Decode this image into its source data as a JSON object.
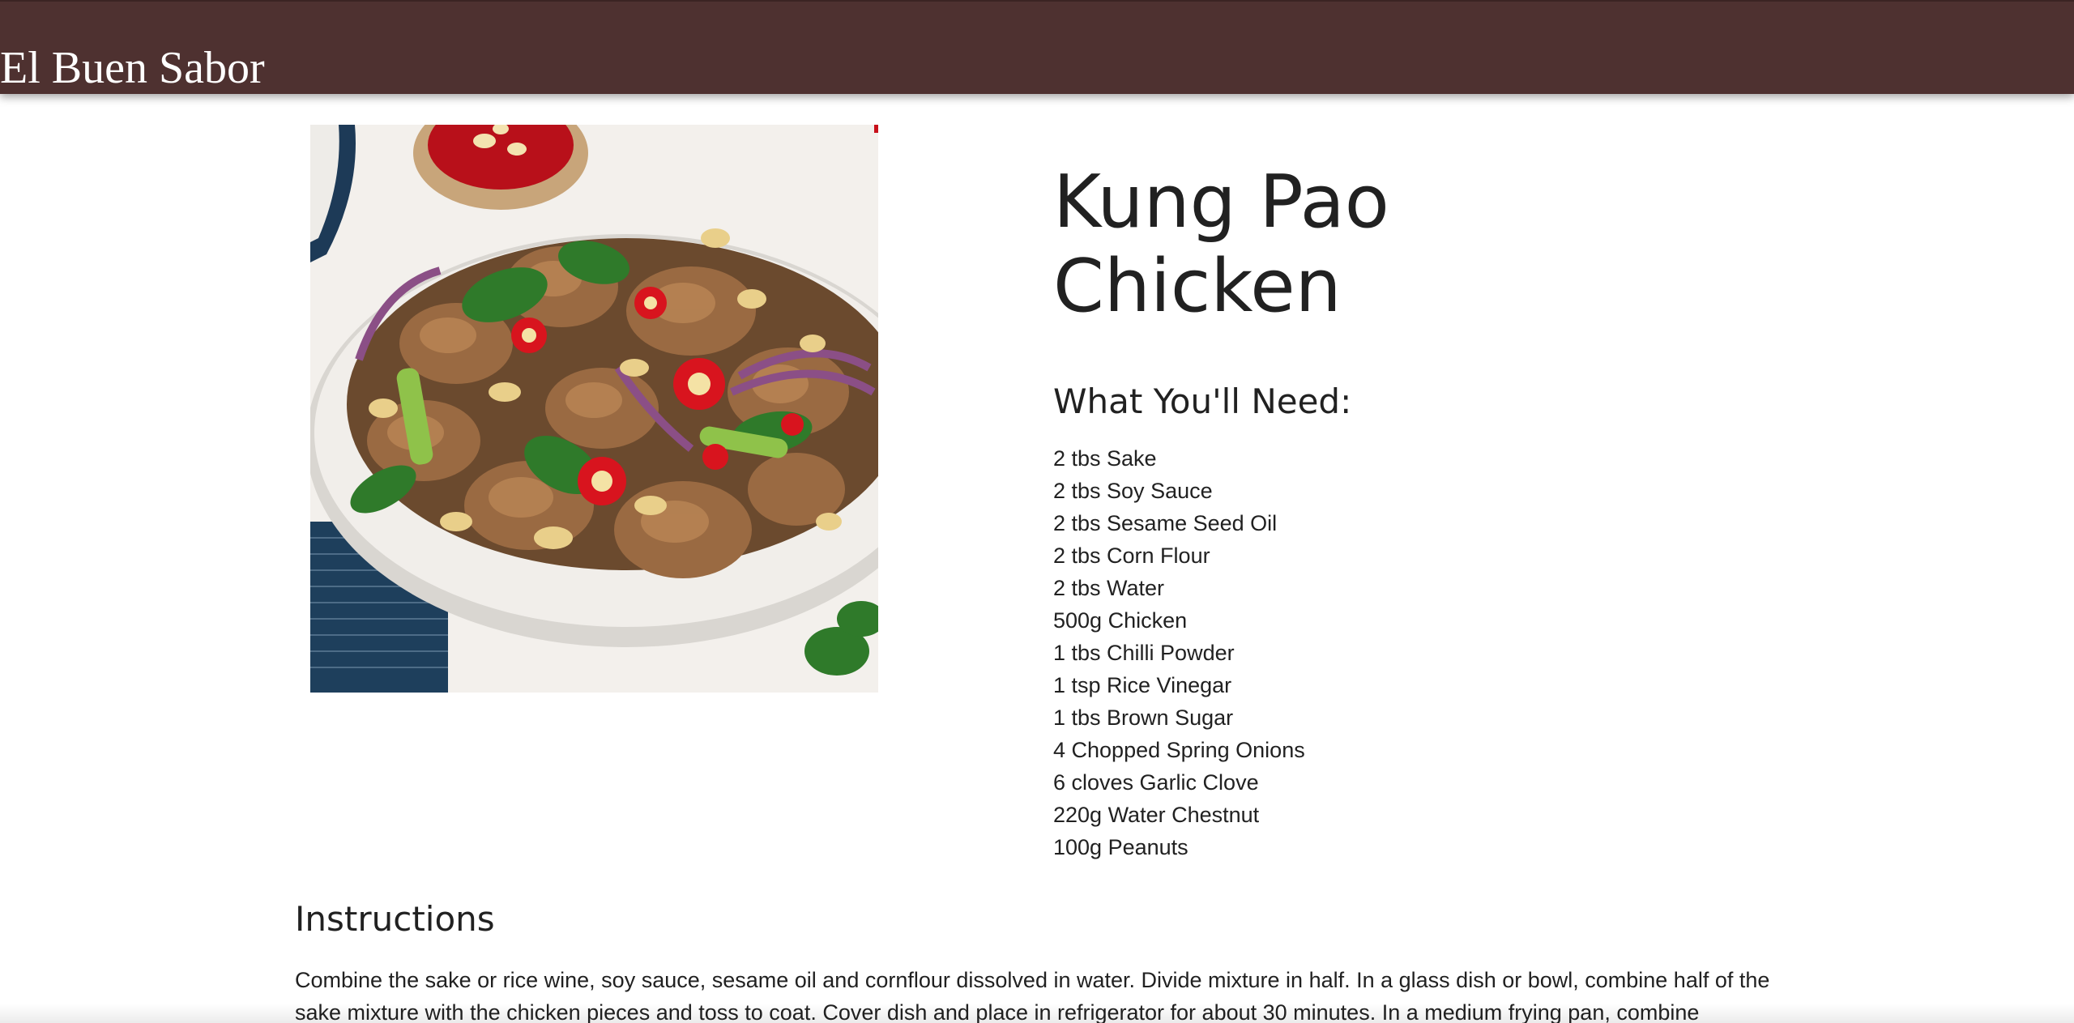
{
  "header": {
    "brand": "El Buen Sabor"
  },
  "recipe": {
    "title_lines": [
      "Kung Pao",
      "Chicken"
    ],
    "image_icon": "kung-pao-chicken-photo",
    "ingredients_heading": "What You'll Need:",
    "ingredients": [
      "2 tbs Sake",
      "2 tbs Soy Sauce",
      "2 tbs Sesame Seed Oil",
      "2 tbs Corn Flour",
      "2 tbs Water",
      "500g Chicken",
      "1 tbs Chilli Powder",
      "1 tsp Rice Vinegar",
      "1 tbs Brown Sugar",
      "4 Chopped Spring Onions",
      "6 cloves Garlic Clove",
      "220g Water Chestnut",
      "100g Peanuts"
    ],
    "instructions_heading": "Instructions",
    "instructions_text": "Combine the sake or rice wine, soy sauce, sesame oil and cornflour dissolved in water. Divide mixture in half. In a glass dish or bowl, combine half of the sake mixture with the chicken pieces and toss to coat. Cover dish and place in refrigerator for about 30 minutes. In a medium frying pan, combine"
  },
  "colors": {
    "header_bg": "#4e3130",
    "text": "#212121",
    "background": "#ffffff"
  }
}
